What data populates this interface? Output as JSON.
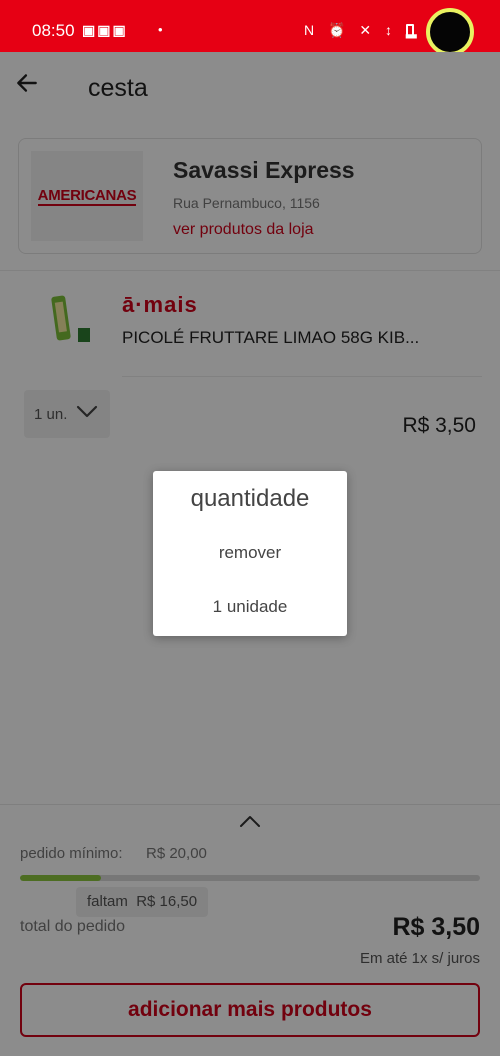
{
  "status_bar": {
    "time": "08:50",
    "notification_icons": "▣▣▣",
    "dot": "•",
    "system_icons": "N ⏰ ✕ ↕ ▂",
    "accent_color": "#e60014"
  },
  "header": {
    "title": "cesta"
  },
  "store": {
    "logo_text": "AMERICANAS",
    "name": "Savassi Express",
    "address": "Rua Pernambuco, 1156",
    "link": "ver produtos da loja"
  },
  "product": {
    "brand": "ā·mais",
    "name": "PICOLÉ FRUTTARE LIMAO 58G KIB...",
    "quantity": "1 un.",
    "price": "R$ 3,50"
  },
  "summary": {
    "min_order_label": "pedido mínimo:",
    "min_order_value": "R$ 20,00",
    "progress_fraction": 0.175,
    "remaining_label": "faltam",
    "remaining_value": "R$ 16,50",
    "total_label": "total do pedido",
    "total_value": "R$ 3,50",
    "installments": "Em até 1x s/ juros",
    "add_more_button": "adicionar mais produtos"
  },
  "dialog": {
    "title": "quantidade",
    "options": [
      "remover",
      "1 unidade"
    ]
  },
  "colors": {
    "brand_red": "#d0021b",
    "progress_fill": "#8dc63f",
    "avatar_ring": "#e9f261"
  }
}
